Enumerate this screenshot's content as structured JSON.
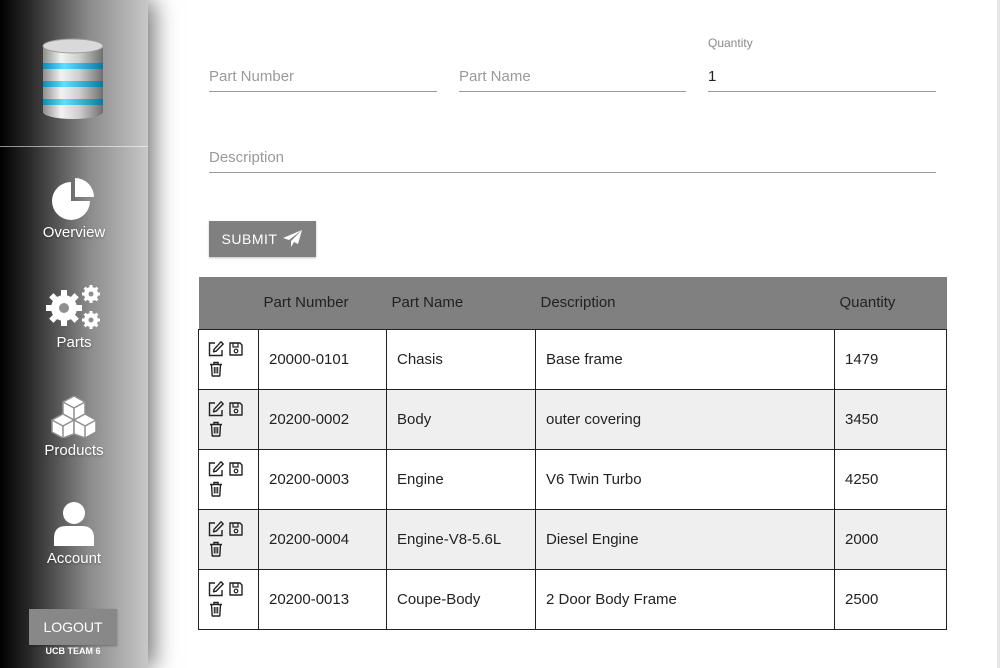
{
  "sidebar": {
    "logo_icon": "database-icon",
    "nav": [
      {
        "label": "Overview",
        "icon": "pie-chart-icon"
      },
      {
        "label": "Parts",
        "icon": "gears-icon"
      },
      {
        "label": "Products",
        "icon": "cubes-icon"
      },
      {
        "label": "Account",
        "icon": "user-icon"
      }
    ],
    "logout_label": "LOGOUT",
    "team_label": "UCB TEAM 6"
  },
  "form": {
    "part_number": {
      "placeholder": "Part Number",
      "value": ""
    },
    "part_name": {
      "placeholder": "Part Name",
      "value": ""
    },
    "quantity": {
      "label": "Quantity",
      "value": "1"
    },
    "description": {
      "placeholder": "Description",
      "value": ""
    },
    "submit_label": "SUBMIT",
    "submit_icon": "paper-plane-icon"
  },
  "table": {
    "headers": [
      "",
      "Part Number",
      "Part Name",
      "Description",
      "Quantity"
    ],
    "action_icons": [
      "edit-icon",
      "save-icon",
      "trash-icon"
    ],
    "rows": [
      {
        "part_number": "20000-0101",
        "part_name": "Chasis",
        "description": "Base frame",
        "quantity": "1479"
      },
      {
        "part_number": "20200-0002",
        "part_name": "Body",
        "description": "outer covering",
        "quantity": "3450"
      },
      {
        "part_number": "20200-0003",
        "part_name": "Engine",
        "description": "V6 Twin Turbo",
        "quantity": "4250"
      },
      {
        "part_number": "20200-0004",
        "part_name": "Engine-V8-5.6L",
        "description": "Diesel Engine",
        "quantity": "2000"
      },
      {
        "part_number": "20200-0013",
        "part_name": "Coupe-Body",
        "description": "2 Door Body Frame",
        "quantity": "2500"
      }
    ]
  },
  "colors": {
    "header_bg": "#808080",
    "button_bg": "#808080",
    "stripe": "#efefef"
  }
}
